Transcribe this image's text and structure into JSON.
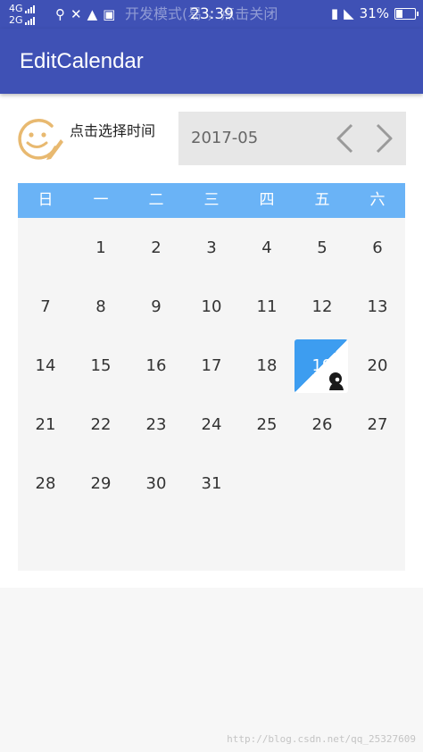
{
  "status_bar": {
    "net_top": "4G",
    "net_bottom": "2G",
    "notice": "开发模式(易    ，点击关闭",
    "time": "23:39",
    "battery": "31%",
    "icons": [
      "usb-icon",
      "tools-icon",
      "qq-icon",
      "app-icon",
      "lock-icon",
      "mute-icon",
      "battery-icon"
    ]
  },
  "app_bar": {
    "title": "EditCalendar"
  },
  "picker": {
    "label": "点击选择时间",
    "month": "2017-05",
    "icons": [
      "smiley-edit-icon",
      "chevron-left-icon",
      "chevron-right-icon"
    ]
  },
  "calendar": {
    "weekdays": [
      "日",
      "一",
      "二",
      "三",
      "四",
      "五",
      "六"
    ],
    "days": [
      "1",
      "2",
      "3",
      "4",
      "5",
      "6",
      "7",
      "8",
      "9",
      "10",
      "11",
      "12",
      "13",
      "14",
      "15",
      "16",
      "17",
      "18",
      "19",
      "20",
      "21",
      "22",
      "23",
      "24",
      "25",
      "26",
      "27",
      "28",
      "29",
      "30",
      "31"
    ],
    "first_weekday": 1,
    "selected_day": "19",
    "colors": {
      "header": "#6ab3f6",
      "selected": "#3d9df0",
      "background": "#f5f5f5"
    }
  },
  "colors": {
    "primary": "#3f51b5"
  },
  "watermark": "http://blog.csdn.net/qq_25327609"
}
